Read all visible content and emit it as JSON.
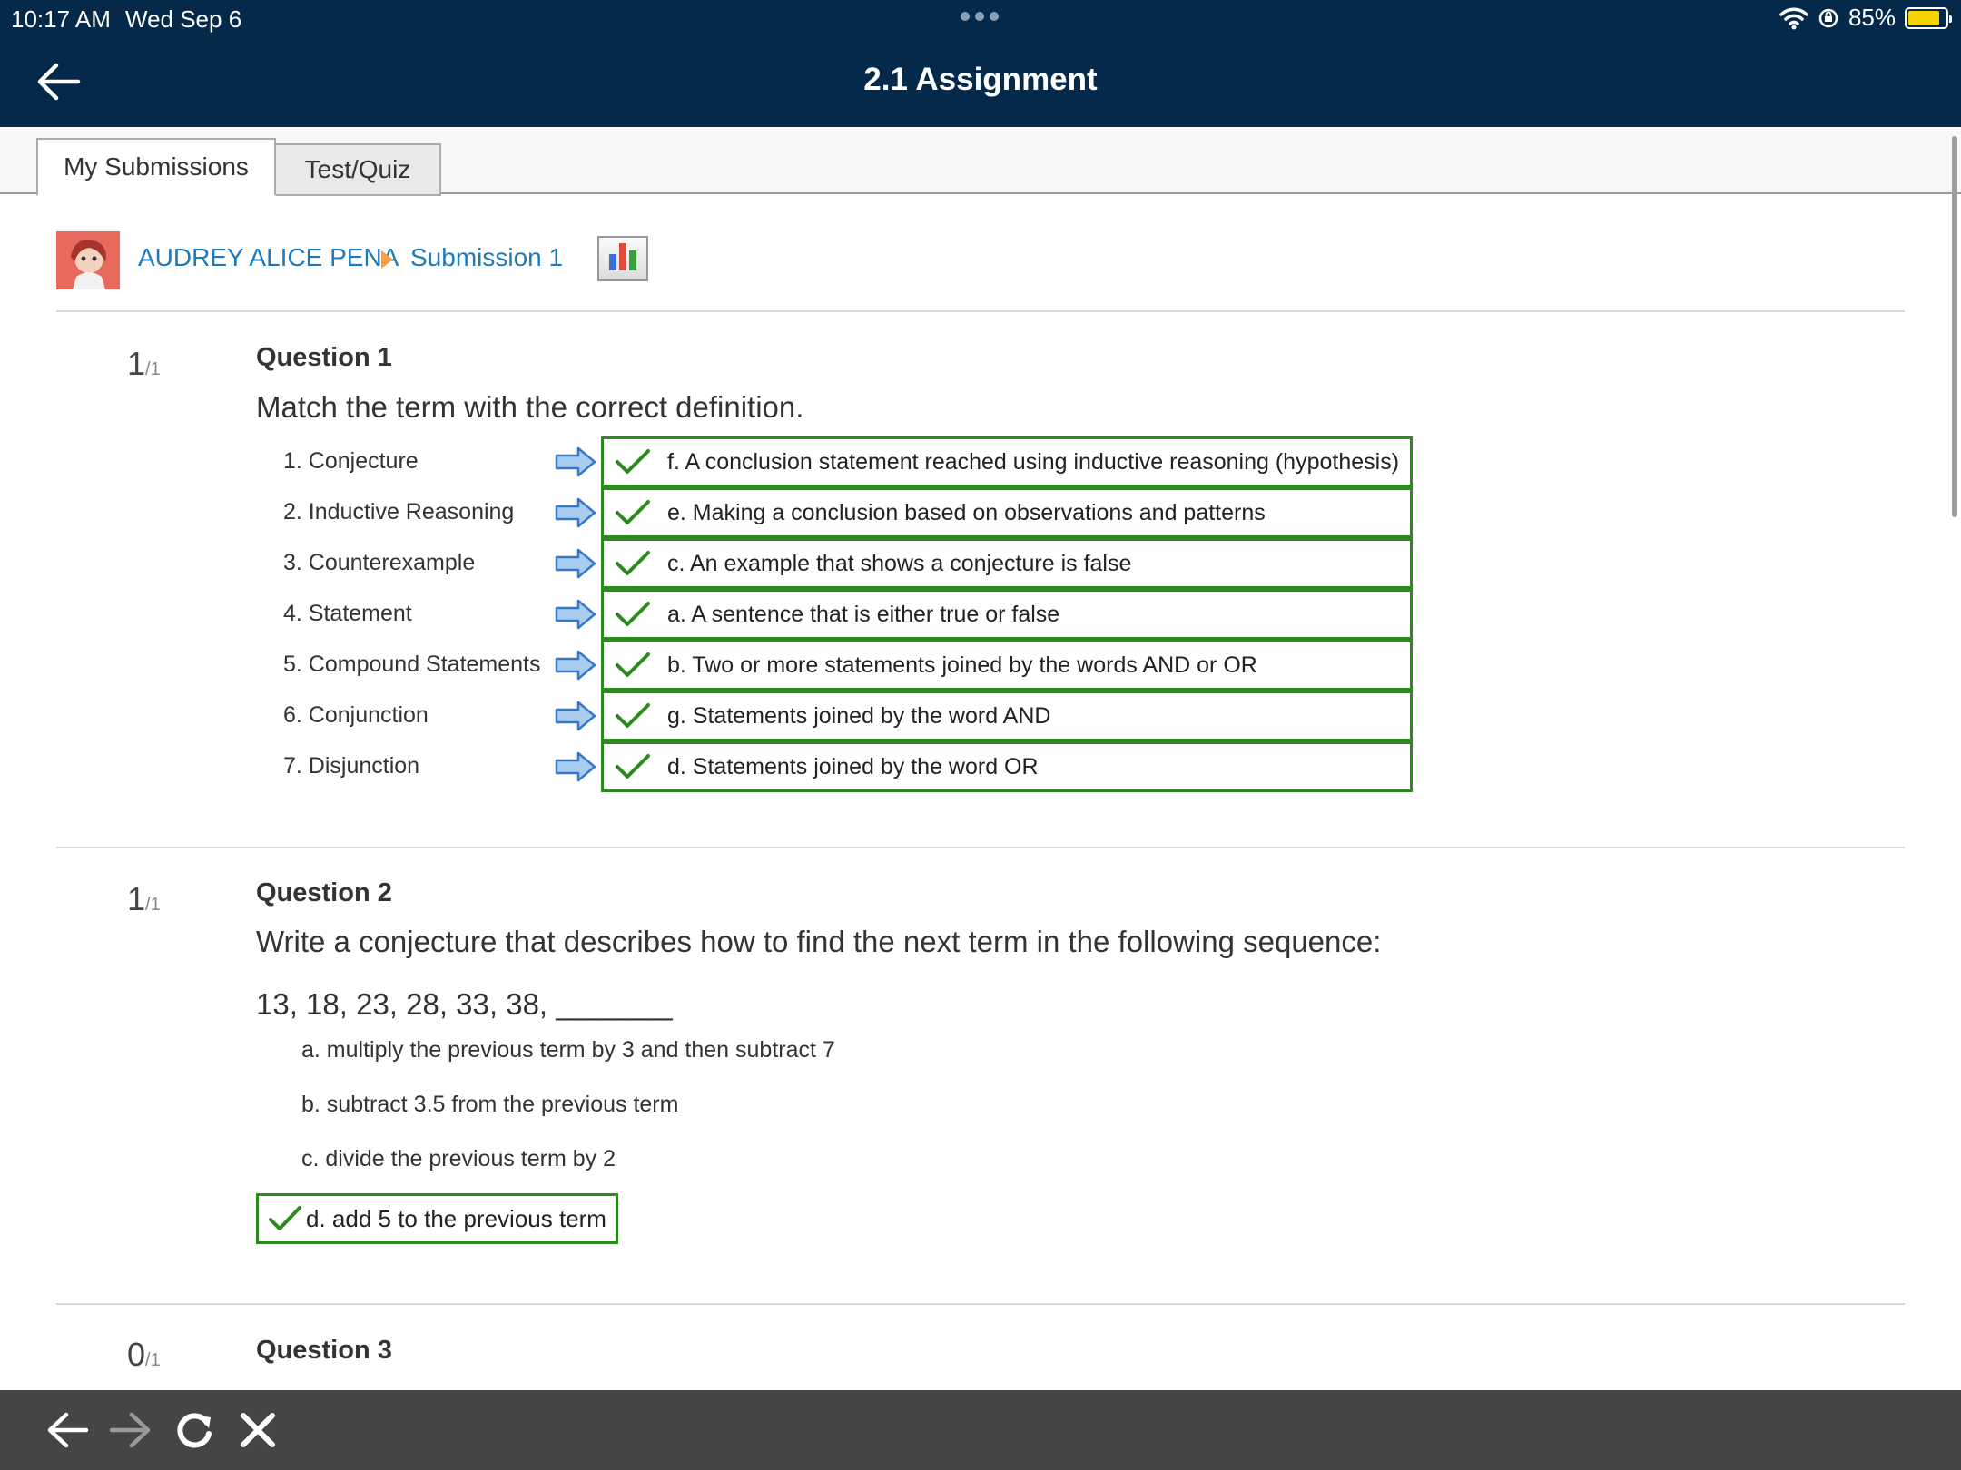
{
  "status_bar": {
    "time": "10:17 AM",
    "date": "Wed Sep 6",
    "battery_text": "85%",
    "battery_level": 0.85
  },
  "header": {
    "title": "2.1 Assignment",
    "background": "#04294a"
  },
  "tabs": [
    {
      "label": "My Submissions",
      "active": true
    },
    {
      "label": "Test/Quiz",
      "active": false
    }
  ],
  "breadcrumb": {
    "user": "AUDREY ALICE PENA",
    "submission": "Submission 1",
    "link_color": "#1f7ab8"
  },
  "questions": [
    {
      "score": "1",
      "max": "/1",
      "title": "Question 1",
      "prompt": "Match the term with the correct definition.",
      "pairs": [
        {
          "term": "1. Conjecture",
          "answer": "f. A conclusion statement reached using inductive reasoning (hypothesis)"
        },
        {
          "term": "2. Inductive Reasoning",
          "answer": "e. Making a conclusion based on observations and patterns"
        },
        {
          "term": "3. Counterexample",
          "answer": "c. An example that shows a conjecture is false"
        },
        {
          "term": "4. Statement",
          "answer": "a. A sentence that is either true or false"
        },
        {
          "term": "5. Compound Statements",
          "answer": "b. Two or more statements joined by the words AND or OR"
        },
        {
          "term": "6. Conjunction",
          "answer": "g. Statements joined by the word AND"
        },
        {
          "term": "7. Disjunction",
          "answer": "d. Statements joined by the word OR"
        }
      ]
    },
    {
      "score": "1",
      "max": "/1",
      "title": "Question 2",
      "prompt": "Write a conjecture that describes how to find the next term in the following sequence:",
      "sequence": "13, 18, 23, 28, 33, 38, _______",
      "choices": [
        "a. multiply the previous term by 3 and then subtract 7",
        "b. subtract 3.5 from the previous term",
        "c. divide the previous term by 2"
      ],
      "selected": "d. add 5 to the previous term"
    },
    {
      "score": "0",
      "max": "/1",
      "title": "Question 3"
    }
  ],
  "colors": {
    "correct": "#2d8a1f",
    "arrow_fill": "#a9ccf0",
    "arrow_stroke": "#3a78c4",
    "toolbar": "#454545"
  },
  "icons": {
    "back": "arrow-left-icon",
    "forward": "arrow-right-icon",
    "reload": "reload-icon",
    "close": "close-icon",
    "check": "checkmark-icon",
    "match_arrow": "block-arrow-right-icon",
    "chart": "bar-chart-icon"
  }
}
